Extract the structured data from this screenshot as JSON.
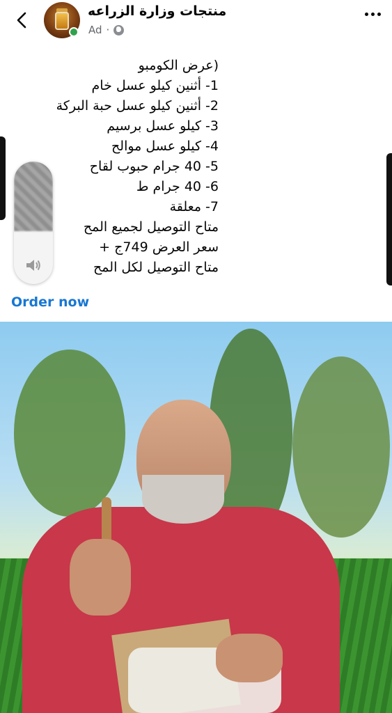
{
  "header": {
    "back_icon": "chevron-left-icon",
    "page_name": "منتجات وزارة الزراعه",
    "ad_label": "Ad",
    "privacy_icon": "globe-icon",
    "more_icon": "more-horizontal-icon",
    "online_status_color": "#31a24c"
  },
  "post": {
    "lines": [
      "(عرض الكومبو",
      "1-  أثنين كيلو عسل خام",
      "2- أثنين كيلو عسل حبة البركة",
      "3- كيلو عسل برسيم",
      "4- كيلو عسل موالح",
      "5- 40 جرام حبوب لقاح",
      "6- 40 جرام ط",
      "7- معلقة",
      "متاح التوصيل لجميع المح",
      "سعر العرض 749ج +",
      "متاح التوصيل لكل المح"
    ]
  },
  "video_overlay": {
    "speaker_icon": "speaker-icon"
  },
  "cta": {
    "label": "Order now",
    "color": "#1877d2"
  }
}
